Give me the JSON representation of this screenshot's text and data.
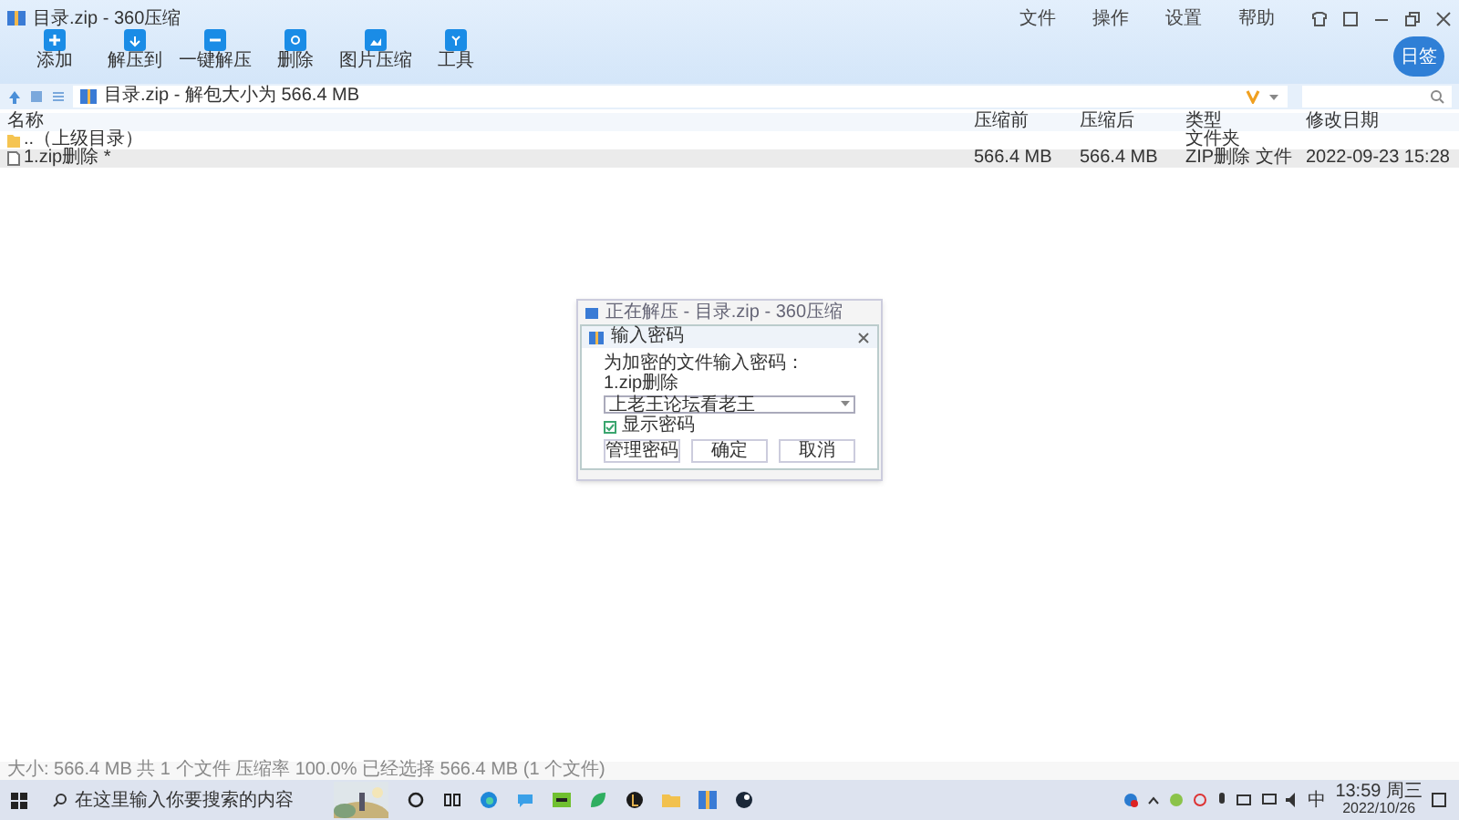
{
  "window": {
    "title": "目录.zip - 360压缩",
    "menu": [
      "文件",
      "操作",
      "设置",
      "帮助"
    ],
    "badge": "日签"
  },
  "toolbar": [
    {
      "label": "添加"
    },
    {
      "label": "解压到"
    },
    {
      "label": "一键解压"
    },
    {
      "label": "删除"
    },
    {
      "label": "图片压缩"
    },
    {
      "label": "工具"
    }
  ],
  "address": {
    "path": "目录.zip - 解包大小为 566.4 MB"
  },
  "table": {
    "columns": [
      "名称",
      "压缩前",
      "压缩后",
      "类型",
      "修改日期"
    ],
    "rows": [
      {
        "kind": "folder",
        "selected": false,
        "cells": [
          "..（上级目录）",
          "",
          "",
          "文件夹",
          ""
        ]
      },
      {
        "kind": "file",
        "selected": true,
        "cells": [
          "1.zip删除 *",
          "566.4 MB",
          "566.4 MB",
          "ZIP删除 文件",
          "2022-09-23 15:28"
        ]
      }
    ]
  },
  "background_window": {
    "title": "正在解压 - 目录.zip - 360压缩"
  },
  "dialog": {
    "title": "输入密码",
    "prompt": "为加密的文件输入密码：",
    "filename": "1.zip删除",
    "password": "上老王论坛看老王",
    "show_password": {
      "label": "显示密码",
      "checked": true
    },
    "buttons": [
      "管理密码",
      "确定",
      "取消"
    ]
  },
  "status_bar": "大小: 566.4 MB 共 1 个文件 压缩率 100.0% 已经选择 566.4 MB (1 个文件)",
  "taskbar": {
    "search_placeholder": "在这里输入你要搜索的内容",
    "time": "13:59 周三",
    "date": "2022/10/26",
    "ime": "中"
  }
}
